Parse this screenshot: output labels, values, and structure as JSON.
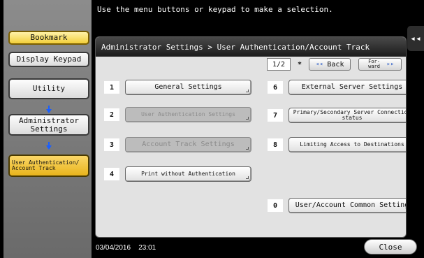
{
  "header": {
    "instruction": "Use the menu buttons or keypad to make a selection."
  },
  "sidebar": {
    "bookmark": "Bookmark",
    "display_keypad": "Display Keypad",
    "utility": "Utility",
    "admin_settings": "Administrator Settings",
    "current": "User Authentication/ Account Track"
  },
  "panel": {
    "breadcrumb": "Administrator Settings > User Authentication/Account Track",
    "pager": {
      "page": "1/2",
      "star": "*",
      "back": "Back",
      "forward": "For- ward",
      "hash": "#"
    },
    "left_items": [
      {
        "num": "1",
        "label": "General Settings"
      },
      {
        "num": "2",
        "label": "User Authentication Settings"
      },
      {
        "num": "3",
        "label": "Account Track Settings"
      },
      {
        "num": "4",
        "label": "Print without Authentication"
      }
    ],
    "right_items": [
      {
        "num": "6",
        "label": "External Server Settings"
      },
      {
        "num": "7",
        "label": "Primary/Secondary Server Connection status"
      },
      {
        "num": "8",
        "label": "Limiting Access to Destinations"
      },
      {
        "num": "0",
        "label": "User/Account Common Setting"
      }
    ]
  },
  "footer": {
    "date": "03/04/2016",
    "time": "23:01",
    "close": "Close"
  }
}
